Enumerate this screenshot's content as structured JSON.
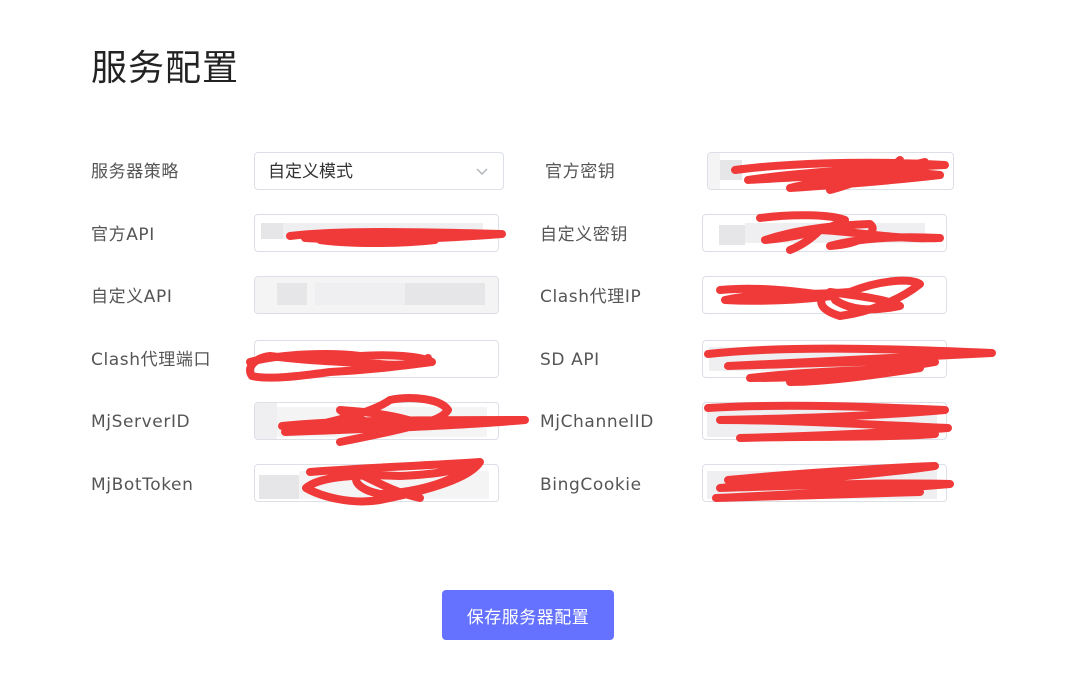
{
  "page": {
    "title": "服务配置"
  },
  "form": {
    "server_strategy": {
      "label": "服务器策略",
      "value": "自定义模式"
    },
    "official_key": {
      "label": "官方密钥"
    },
    "official_api": {
      "label": "官方API"
    },
    "custom_key": {
      "label": "自定义密钥"
    },
    "custom_api": {
      "label": "自定义API"
    },
    "clash_proxy_ip": {
      "label": "Clash代理IP"
    },
    "clash_proxy_port": {
      "label": "Clash代理端口"
    },
    "sd_api": {
      "label": "SD API"
    },
    "mj_server_id": {
      "label": "MjServerID"
    },
    "mj_channel_id": {
      "label": "MjChannelID"
    },
    "mj_bot_token": {
      "label": "MjBotToken"
    },
    "bing_cookie": {
      "label": "BingCookie"
    }
  },
  "actions": {
    "save_label": "保存服务器配置"
  },
  "colors": {
    "primary_button": "#6472ff",
    "redaction": "#f03a3a",
    "border": "#dcdfe6"
  },
  "icons": {
    "select_arrow": "chevron-down-icon"
  }
}
